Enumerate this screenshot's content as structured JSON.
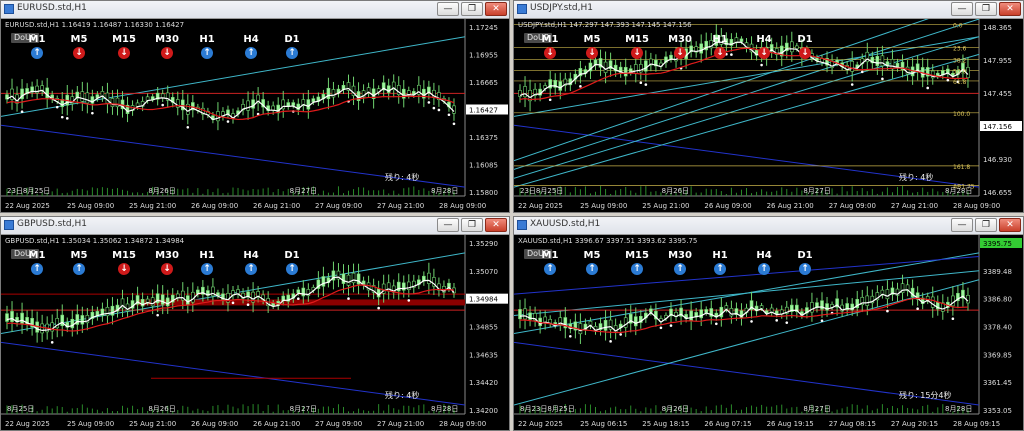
{
  "timeframes": [
    "M1",
    "M5",
    "M15",
    "M30",
    "H1",
    "H4",
    "D1"
  ],
  "charts": [
    {
      "id": "eur",
      "title": "EURUSD.std,H1",
      "info": "EURUSD.std,H1  1.16419 1.16487 1.16330 1.16427",
      "button": "DoUP",
      "remain": "残り: 4秒",
      "arrows": [
        "up",
        "dn",
        "dn",
        "dn",
        "up",
        "up",
        "up"
      ],
      "price_labels": [
        "1.17245",
        "1.16955",
        "1.16665",
        "1.16427",
        "1.16375",
        "1.16085",
        "1.15800"
      ],
      "current_price": "1.16427",
      "time_labels": [
        "22 Aug 2025",
        "25 Aug 09:00",
        "25 Aug 21:00",
        "26 Aug 09:00",
        "26 Aug 21:00",
        "27 Aug 09:00",
        "27 Aug 21:00",
        "28 Aug 09:00"
      ],
      "date_markers": [
        "23日8月25日",
        "8月26日",
        "8月27日",
        "8月28日"
      ]
    },
    {
      "id": "jpy",
      "title": "USDJPY.std,H1",
      "info": "USDJPY.std,H1  147.297 147.393 147.145 147.156",
      "button": "DoUP",
      "remain": "残り: 4秒",
      "arrows": [
        "dn",
        "dn",
        "dn",
        "dn",
        "dn",
        "dn",
        "dn"
      ],
      "price_labels": [
        "148.365",
        "147.955",
        "147.455",
        "147.156",
        "146.930",
        "146.655"
      ],
      "fib_labels": [
        "0.0",
        "23.6",
        "38.2",
        "50.0",
        "61.8",
        "100.0",
        "161.8",
        "AB1.75"
      ],
      "current_price": "147.156",
      "time_labels": [
        "22 Aug 2025",
        "25 Aug 09:00",
        "25 Aug 21:00",
        "26 Aug 09:00",
        "26 Aug 21:00",
        "27 Aug 09:00",
        "27 Aug 21:00",
        "28 Aug 09:00"
      ],
      "date_markers": [
        "23日8月25日",
        "8月26日",
        "8月27日",
        "8月28日"
      ]
    },
    {
      "id": "gbp",
      "title": "GBPUSD.std,H1",
      "info": "GBPUSD.std,H1  1.35034 1.35062 1.34872 1.34984",
      "button": "DoUP",
      "remain": "残り: 4秒",
      "arrows": [
        "up",
        "up",
        "dn",
        "dn",
        "up",
        "up",
        "up"
      ],
      "price_labels": [
        "1.35290",
        "1.35070",
        "1.34984",
        "1.34855",
        "1.34635",
        "1.34420",
        "1.34200"
      ],
      "current_price": "1.34984",
      "time_labels": [
        "22 Aug 2025",
        "25 Aug 09:00",
        "25 Aug 21:00",
        "26 Aug 09:00",
        "26 Aug 21:00",
        "27 Aug 09:00",
        "27 Aug 21:00",
        "28 Aug 09:00"
      ],
      "date_markers": [
        "8月25日",
        "8月26日",
        "8月27日",
        "8月28日"
      ]
    },
    {
      "id": "xau",
      "title": "XAUUSD.std,H1",
      "info": "XAUUSD.std,H1  3396.67 3397.51 3393.62 3395.75",
      "button": "DoUP",
      "remain": "残り: 15分4秒",
      "arrows": [
        "up",
        "up",
        "up",
        "up",
        "up",
        "up",
        "up"
      ],
      "price_labels": [
        "3395.75",
        "3389.48",
        "3386.80",
        "3378.40",
        "3369.85",
        "3361.45",
        "3353.05"
      ],
      "current_price": "3395.75",
      "time_labels": [
        "22 Aug 2025",
        "25 Aug 06:15",
        "25 Aug 18:15",
        "26 Aug 07:15",
        "26 Aug 19:15",
        "27 Aug 08:15",
        "27 Aug 20:15",
        "28 Aug 09:15"
      ],
      "date_markers": [
        "8月23日8月25日",
        "8月26日",
        "8月27日",
        "8月28日"
      ]
    }
  ]
}
